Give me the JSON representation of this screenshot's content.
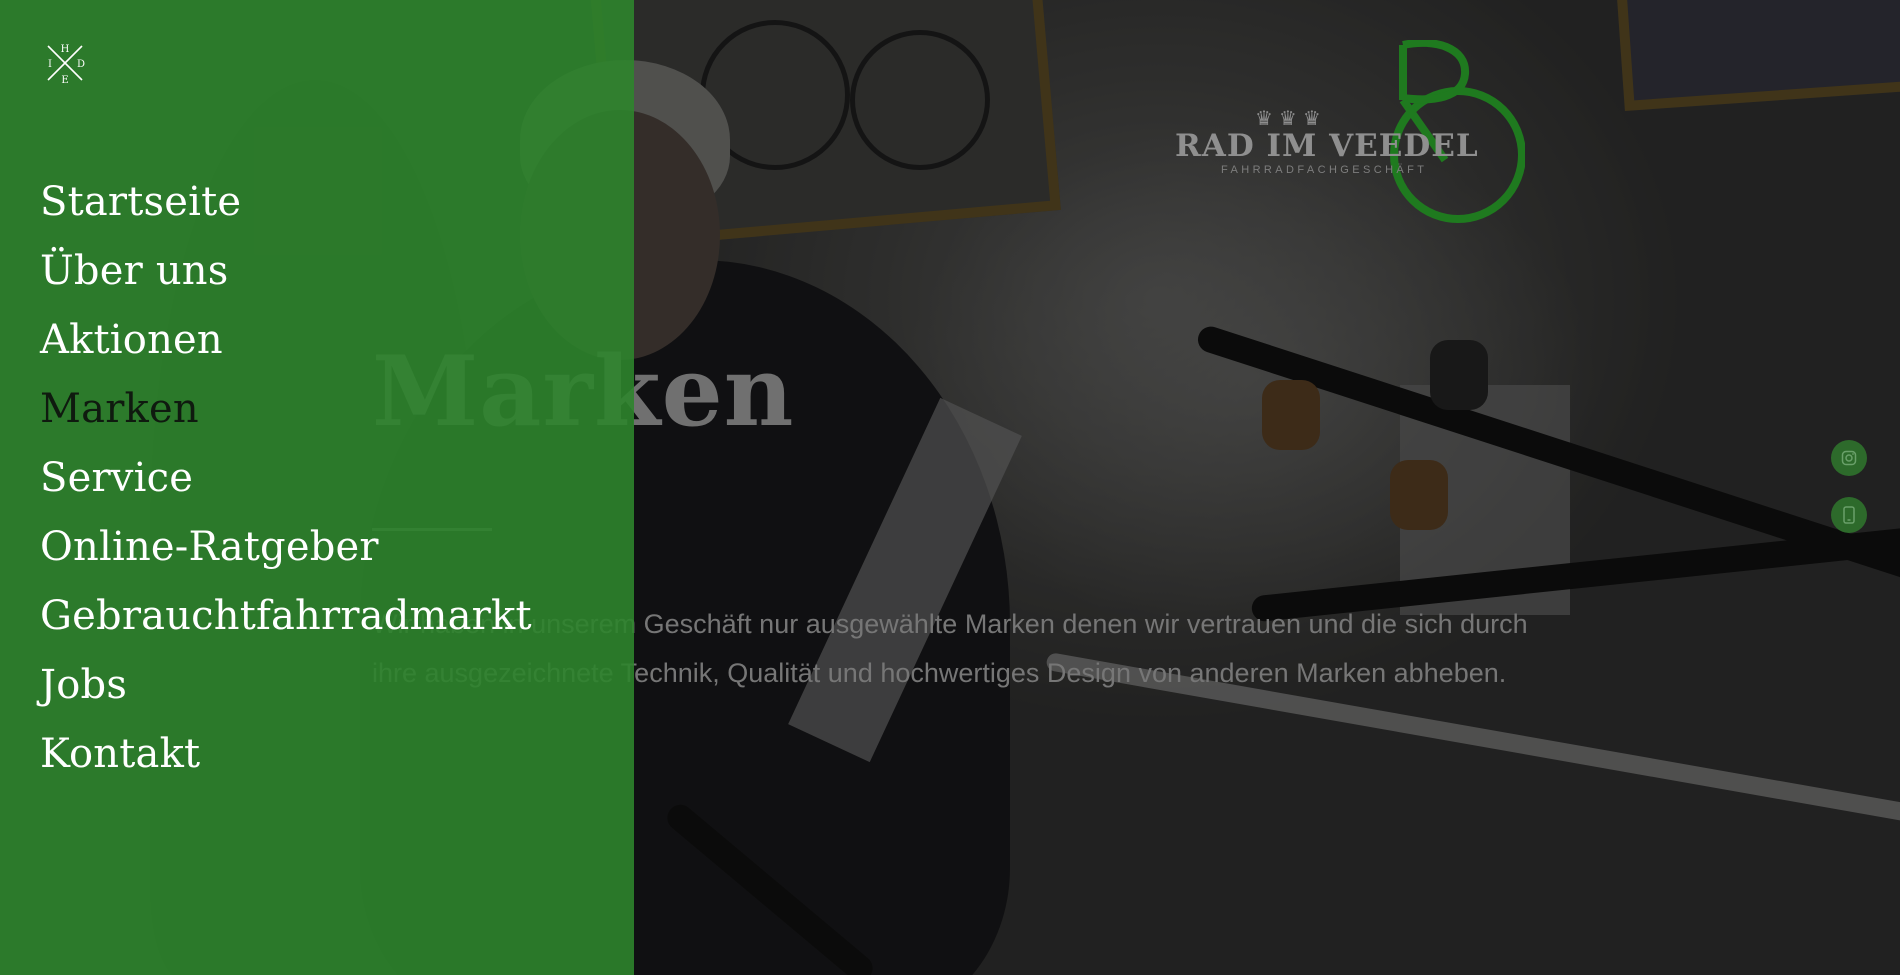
{
  "menu": {
    "close_label": "H I D E",
    "close_letters": {
      "top": "H",
      "left": "I",
      "right": "D",
      "bottom": "E"
    },
    "items": [
      {
        "label": "Startseite",
        "active": false
      },
      {
        "label": "Über uns",
        "active": false
      },
      {
        "label": "Aktionen",
        "active": false
      },
      {
        "label": "Marken",
        "active": true
      },
      {
        "label": "Service",
        "active": false
      },
      {
        "label": "Online-Ratgeber",
        "active": false
      },
      {
        "label": "Gebrauchtfahrradmarkt",
        "active": false
      },
      {
        "label": "Jobs",
        "active": false
      },
      {
        "label": "Kontakt",
        "active": false
      }
    ]
  },
  "brand": {
    "name": "RAD IM VEEDEL",
    "tagline": "FAHRRADFACHGESCHÄFT",
    "crowns": "♛♛♛"
  },
  "hero": {
    "heading": "Marken",
    "intro": "Wir haben in unserem Geschäft nur ausgewählte Marken denen wir vertrauen und die sich durch ihre ausgezeichnete Technik, Qualität und hochwertiges Design von anderen Marken abheben."
  },
  "social": {
    "instagram_icon": "instagram-icon",
    "phone_icon": "phone-icon"
  },
  "colors": {
    "menu_green": "#2e842c",
    "accent_green": "#2a8a2a",
    "active_text": "#0f1a0f"
  }
}
